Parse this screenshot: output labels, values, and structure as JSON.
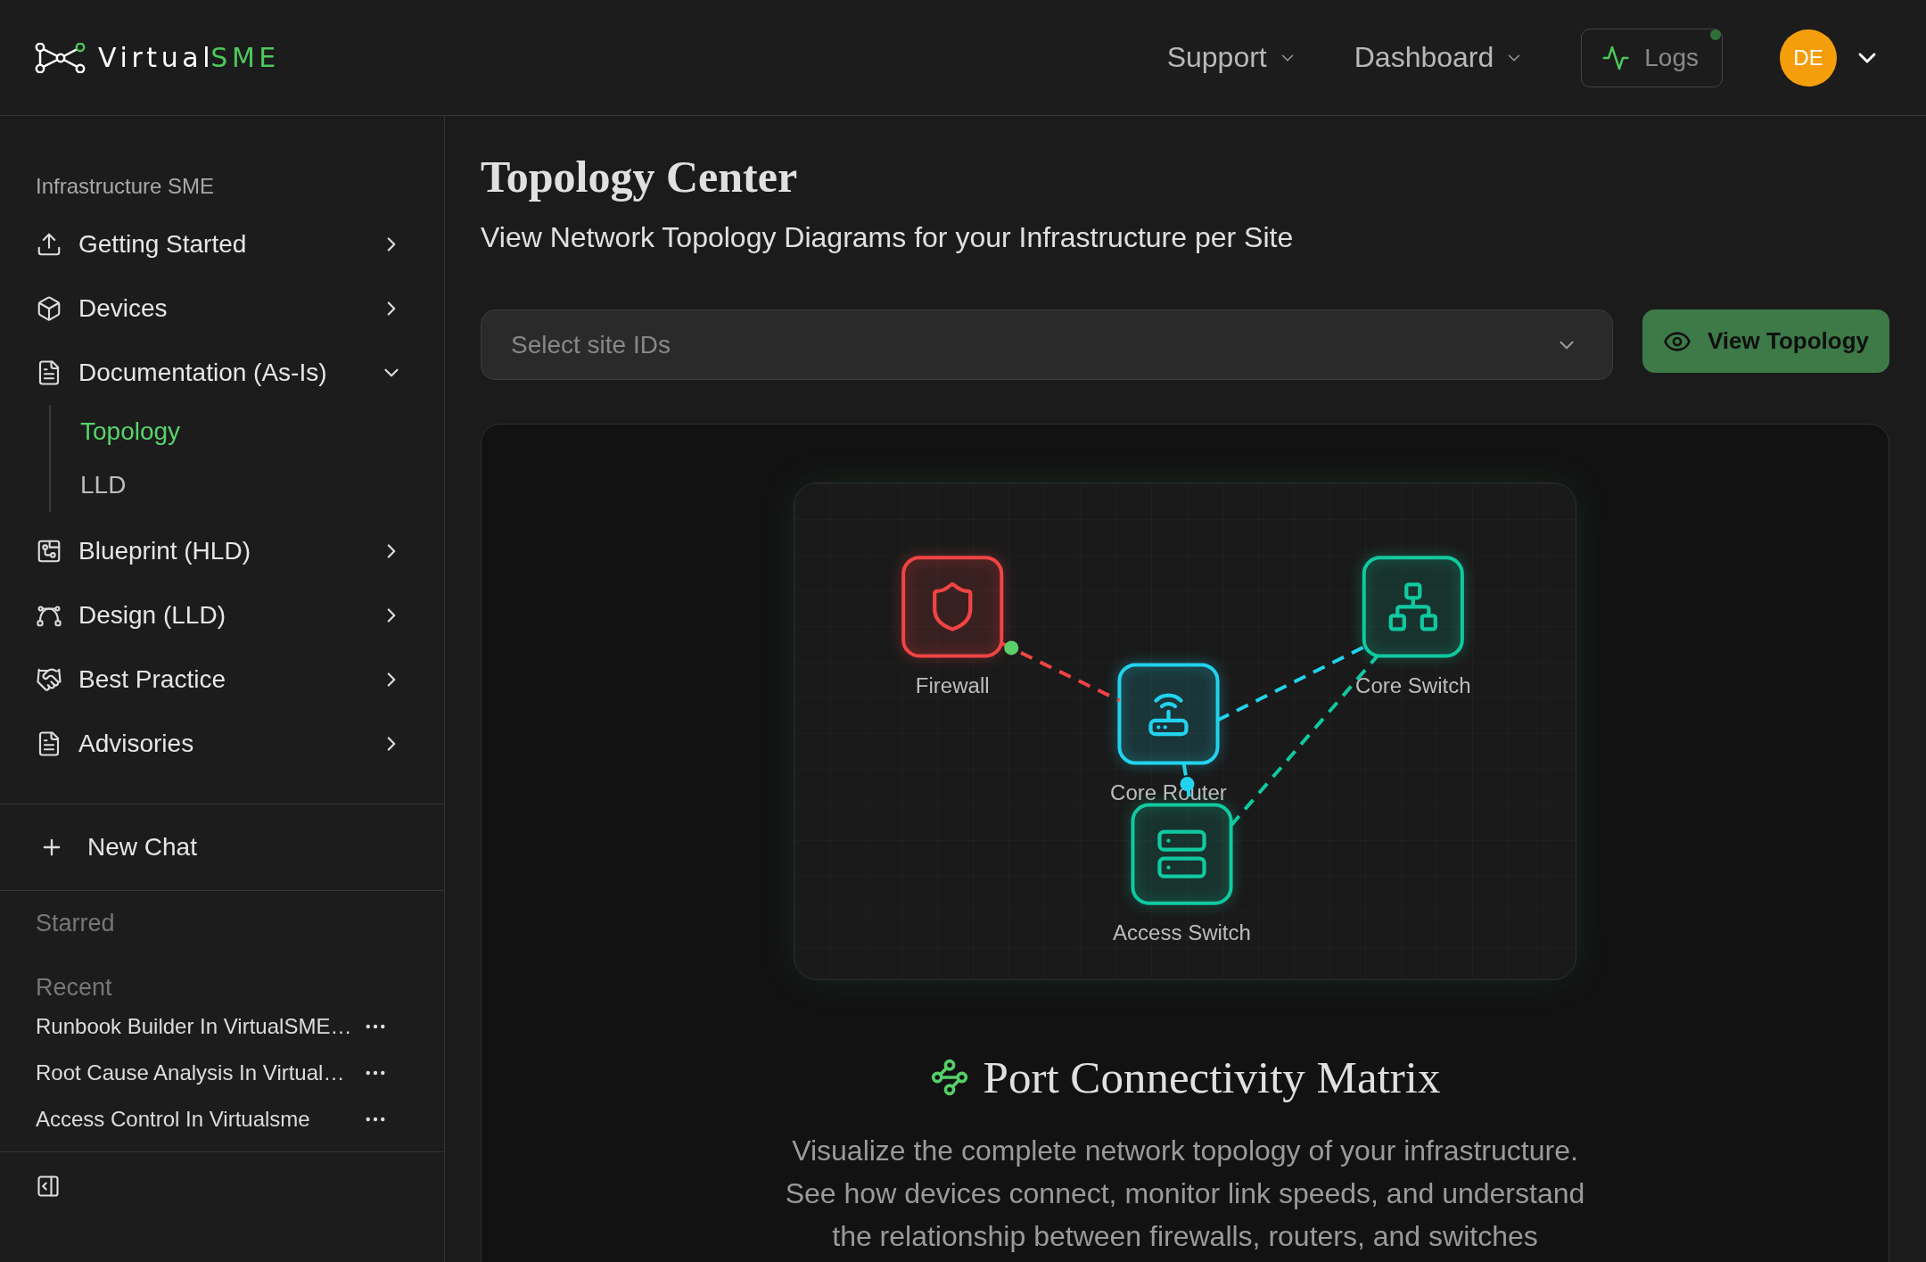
{
  "header": {
    "brand": {
      "text": "Virtual",
      "accent": "SME"
    },
    "nav": [
      {
        "label": "Support"
      },
      {
        "label": "Dashboard"
      }
    ],
    "logs": {
      "label": "Logs",
      "unread": true
    },
    "avatar": {
      "initials": "DE"
    }
  },
  "sidebar": {
    "title": "Infrastructure SME",
    "items": [
      {
        "label": "Getting Started",
        "expanded": false
      },
      {
        "label": "Devices",
        "expanded": false
      },
      {
        "label": "Documentation (As-Is)",
        "expanded": true,
        "children": [
          {
            "label": "Topology",
            "selected": true
          },
          {
            "label": "LLD",
            "selected": false
          }
        ]
      },
      {
        "label": "Blueprint (HLD)",
        "expanded": false
      },
      {
        "label": "Design (LLD)",
        "expanded": false
      },
      {
        "label": "Best Practice",
        "expanded": false
      },
      {
        "label": "Advisories",
        "expanded": false
      }
    ],
    "new_chat": {
      "label": "New Chat"
    },
    "starred": {
      "title": "Starred"
    },
    "recent": {
      "title": "Recent",
      "items": [
        {
          "title": "Runbook Builder In VirtualSME…"
        },
        {
          "title": "Root Cause Analysis In Virtual…"
        },
        {
          "title": "Access Control In Virtualsme"
        }
      ]
    }
  },
  "main": {
    "title": "Topology Center",
    "subtitle": "View Network Topology Diagrams for your Infrastructure per Site",
    "site_select": {
      "placeholder": "Select site IDs"
    },
    "view_button": {
      "label": "View Topology"
    },
    "diagram": {
      "nodes": [
        {
          "label": "Firewall",
          "kind": "firewall",
          "color": "#f04444"
        },
        {
          "label": "Core Router",
          "kind": "router",
          "color": "#22d3ee"
        },
        {
          "label": "Core Switch",
          "kind": "core",
          "color": "#10c9a0"
        },
        {
          "label": "Access Switch",
          "kind": "access",
          "color": "#10c9a0"
        }
      ],
      "links": [
        {
          "color": "#f04444",
          "dot": {
            "color": "#5ccf6a"
          }
        },
        {
          "color": "#22d3ee"
        },
        {
          "color": "#22d3ee",
          "dot": {
            "color": "#22d3ee"
          }
        },
        {
          "color": "#10c9a0"
        }
      ]
    },
    "info": {
      "title": "Port Connectivity Matrix",
      "description": "Visualize the complete network topology of your infrastructure. See how devices connect, monitor link speeds, and understand the relationship between firewalls, routers, and switches"
    }
  }
}
